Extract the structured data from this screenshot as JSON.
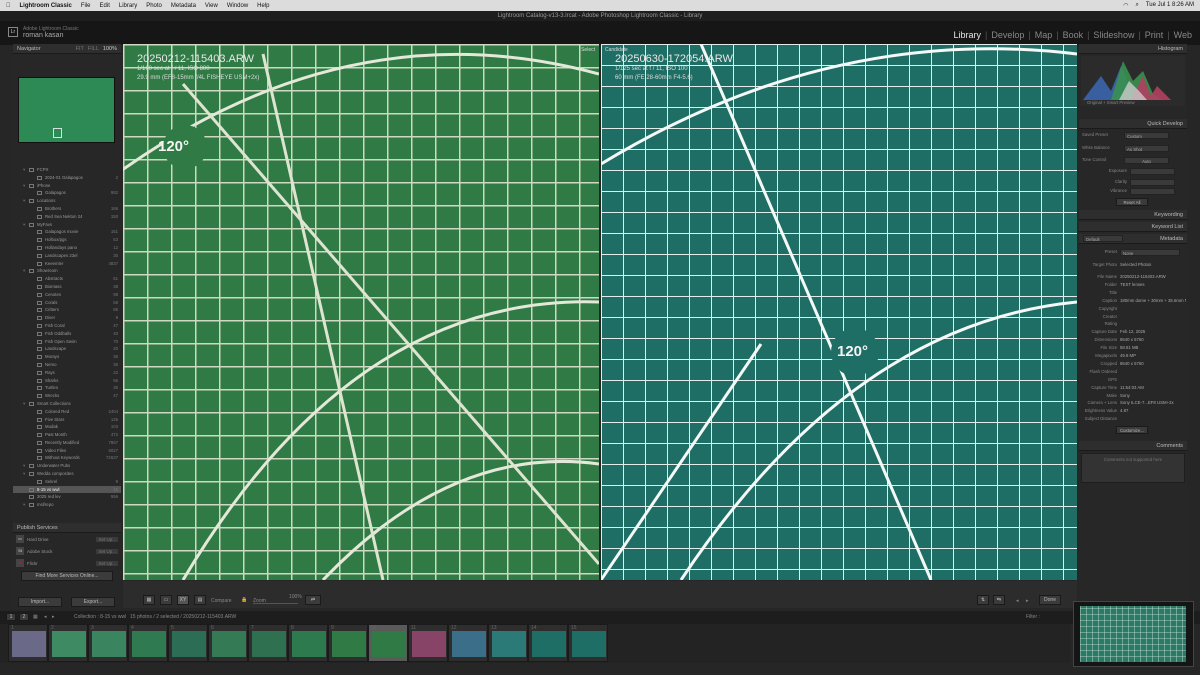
{
  "menubar": {
    "app": "Lightroom Classic",
    "items": [
      "File",
      "Edit",
      "Library",
      "Photo",
      "Metadata",
      "View",
      "Window",
      "Help"
    ],
    "clock": "Tue Jul 1 8:26 AM"
  },
  "window_title": "Lightroom Catalog-v13-3.lrcat - Adobe Photoshop Lightroom Classic - Library",
  "identity": {
    "line1": "Adobe Lightroom Classic",
    "line2": "roman kasan"
  },
  "modules": [
    "Library",
    "Develop",
    "Map",
    "Book",
    "Slideshow",
    "Print",
    "Web"
  ],
  "active_module": "Library",
  "navigator": {
    "title": "Navigator",
    "zoom": [
      "FIT",
      "FILL",
      "100%"
    ]
  },
  "collections": [
    {
      "n": "FCPX",
      "c": "",
      "lvl": 1
    },
    {
      "n": "2024-01 Galapagos",
      "c": "2",
      "lvl": 2
    },
    {
      "n": "iPhone",
      "c": "",
      "lvl": 1
    },
    {
      "n": "Galapagos",
      "c": "982",
      "lvl": 2
    },
    {
      "n": "Locations",
      "c": "",
      "lvl": 1
    },
    {
      "n": "Brothers",
      "c": "166",
      "lvl": 2
    },
    {
      "n": "Red Sea Nekton 24",
      "c": "150",
      "lvl": 2
    },
    {
      "n": "MyFavs",
      "c": "",
      "lvl": 1
    },
    {
      "n": "Galapagos movie",
      "c": "151",
      "lvl": 2
    },
    {
      "n": "Holbox/pgs",
      "c": "53",
      "lvl": 2
    },
    {
      "n": "Hollandays pano",
      "c": "12",
      "lvl": 2
    },
    {
      "n": "Landscapes 23el",
      "c": "30",
      "lvl": 2
    },
    {
      "n": "Keeemler",
      "c": "4837",
      "lvl": 2
    },
    {
      "n": "Showroom",
      "c": "",
      "lvl": 1
    },
    {
      "n": "Abstracts",
      "c": "61",
      "lvl": 2
    },
    {
      "n": "Biomass",
      "c": "38",
      "lvl": 2
    },
    {
      "n": "Cenotes",
      "c": "98",
      "lvl": 2
    },
    {
      "n": "Corals",
      "c": "68",
      "lvl": 2
    },
    {
      "n": "Critters",
      "c": "86",
      "lvl": 2
    },
    {
      "n": "Diver",
      "c": "9",
      "lvl": 2
    },
    {
      "n": "Fish Coral",
      "c": "47",
      "lvl": 2
    },
    {
      "n": "Fish Oddballs",
      "c": "40",
      "lvl": 2
    },
    {
      "n": "Fish Open Swim",
      "c": "70",
      "lvl": 2
    },
    {
      "n": "Landscape",
      "c": "20",
      "lvl": 2
    },
    {
      "n": "Morays",
      "c": "36",
      "lvl": 2
    },
    {
      "n": "Nemo",
      "c": "36",
      "lvl": 2
    },
    {
      "n": "Rays",
      "c": "22",
      "lvl": 2
    },
    {
      "n": "Sharks",
      "c": "56",
      "lvl": 2
    },
    {
      "n": "Turtles",
      "c": "35",
      "lvl": 2
    },
    {
      "n": "Wrecks",
      "c": "47",
      "lvl": 2
    },
    {
      "n": "Smart Collections",
      "c": "",
      "lvl": 1
    },
    {
      "n": "Colored Red",
      "c": "2404",
      "lvl": 2
    },
    {
      "n": "Five Stars",
      "c": "126",
      "lvl": 2
    },
    {
      "n": "Modak",
      "c": "103",
      "lvl": 2
    },
    {
      "n": "Past Month",
      "c": "472",
      "lvl": 2
    },
    {
      "n": "Recently Modified",
      "c": "7867",
      "lvl": 2
    },
    {
      "n": "Video Files",
      "c": "6027",
      "lvl": 2
    },
    {
      "n": "Without Keywords",
      "c": "72637",
      "lvl": 2
    },
    {
      "n": "Underwater Pubs",
      "c": "",
      "lvl": 1
    },
    {
      "n": "Wedda composites",
      "c": "",
      "lvl": 1
    },
    {
      "n": "Sekrel",
      "c": "9",
      "lvl": 2
    },
    {
      "n": "8-15 vs wwl",
      "c": "15",
      "lvl": 1,
      "sel": true
    },
    {
      "n": "2025 red lev",
      "c": "556",
      "lvl": 1
    },
    {
      "n": "msl/repo",
      "c": "",
      "lvl": 1
    }
  ],
  "publish": {
    "title": "Publish Services",
    "items": [
      {
        "badge": "",
        "name": "Hard Drive",
        "set": "Set Up..."
      },
      {
        "badge": "St",
        "name": "Adobe Stock",
        "set": "Set Up..."
      },
      {
        "badge": "",
        "name": "Flickr",
        "set": "Set Up..."
      }
    ],
    "find_more": "Find More Services Online..."
  },
  "import_btn": "Import...",
  "export_btn": "Export...",
  "select_photo": {
    "tag": "Select",
    "filename": "20250212-115403.ARW",
    "line1": "1/160 sec at f / 11, ISO 800",
    "line2": "29.9 mm (EF8-15mm f/4L FISHEYE USM+2x)",
    "degree": "120°"
  },
  "candidate_photo": {
    "tag": "Candidate",
    "filename": "20250630-172054.ARW",
    "line1": "1/125 sec at f / 11, ISO 100",
    "line2": "60 mm (FE 28-60mm F4-5.6)",
    "degree": "120°"
  },
  "toolbar": {
    "compare": "Compare",
    "zoom": "Zoom",
    "zoom_pct": "100%",
    "done": "Done"
  },
  "histogram": {
    "title": "Histogram",
    "caption": "Original + Smart Preview"
  },
  "quick_develop": {
    "title": "Quick Develop",
    "saved_preset": {
      "k": "Saved Preset",
      "v": "Custom"
    },
    "white_balance": {
      "k": "White Balance",
      "v": "As Shot"
    },
    "tone_control": {
      "k": "Tone Control",
      "v": "Auto"
    },
    "rows": [
      "Exposure",
      "Clarity",
      "Vibrance"
    ],
    "reset": "Reset All"
  },
  "keywording": "Keywording",
  "keyword_list": "Keyword List",
  "metadata": {
    "title": "Metadata",
    "preset_label": "Default",
    "preset": {
      "k": "Preset",
      "v": "None"
    },
    "target": {
      "k": "Target Photo",
      "v": "Selected Photos"
    },
    "rows": [
      {
        "k": "File Name",
        "v": "20250212-115403.ARW"
      },
      {
        "k": "Folder",
        "v": "TEST lenses"
      },
      {
        "k": "Title",
        "v": ""
      },
      {
        "k": "Caption",
        "v": "180mm dome + 30mm + 35.6mm N120120"
      },
      {
        "k": "Copyright",
        "v": ""
      },
      {
        "k": "Creator",
        "v": ""
      },
      {
        "k": "Rating",
        "v": ""
      },
      {
        "k": "Capture Date",
        "v": "Feb 12, 2025"
      },
      {
        "k": "Dimensions",
        "v": "8640 x 5760"
      },
      {
        "k": "File Size",
        "v": "58.81 MB"
      },
      {
        "k": "Megapixels",
        "v": "49.8 MP"
      },
      {
        "k": "Cropped",
        "v": "8640 x 5760"
      },
      {
        "k": "Flash Ordered",
        "v": ""
      },
      {
        "k": "GPS",
        "v": ""
      },
      {
        "k": "Capture Time",
        "v": "11:54:03 AM"
      },
      {
        "k": "Make",
        "v": "Sony"
      },
      {
        "k": "Camera + Lens",
        "v": "Sony ILCE-7...EF8 USM+2x"
      },
      {
        "k": "Brightness Value",
        "v": "4.87"
      },
      {
        "k": "Subject Distance",
        "v": ""
      }
    ],
    "customize": "Customize..."
  },
  "comments": {
    "title": "Comments",
    "placeholder": "Comments not supported here"
  },
  "filmbar": {
    "path": "Collection : 8-15 vs wwl",
    "count": "15 photos / 2 selected / 20250212-115403.ARW",
    "filter": "Filter :"
  },
  "thumbs": [
    "1",
    "2",
    "3",
    "4",
    "5",
    "6",
    "7",
    "8",
    "9",
    "10",
    "11",
    "12",
    "13",
    "14",
    "15"
  ],
  "colors": {
    "select_bg": "#2f7a45",
    "candidate_bg": "#1f6e66",
    "accent": "#e6e6e6"
  }
}
